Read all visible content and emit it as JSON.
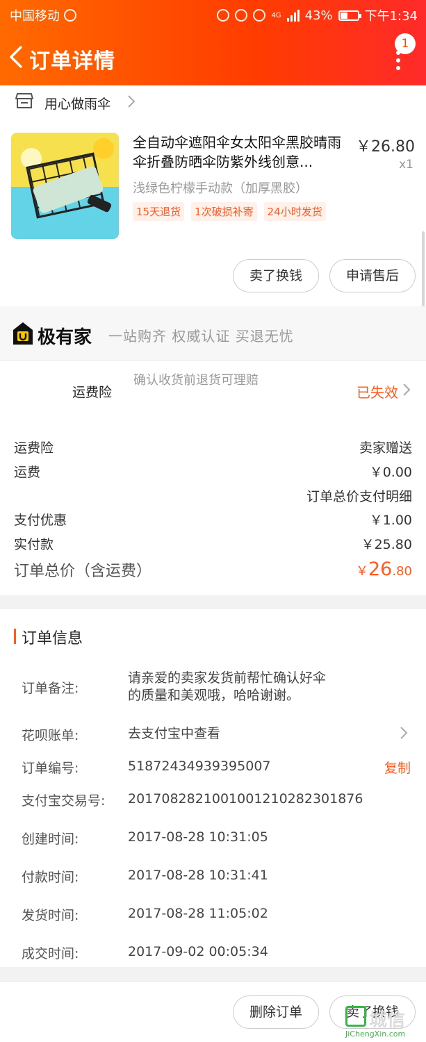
{
  "status_bar": {
    "carrier": "中国移动",
    "network": "4G",
    "battery": "43%",
    "battery_level": 0.43,
    "time": "下午1:34"
  },
  "nav": {
    "title": "订单详情",
    "badge": "1"
  },
  "shop": {
    "name": "用心做雨伞"
  },
  "product": {
    "title": "全自动伞遮阳伞女太阳伞黑胶晴雨伞折叠防晒伞防紫外线创意...",
    "price": "￥26.80",
    "qty": "x1",
    "sku": "浅绿色柠檬手动款（加厚黑胶）",
    "tags": [
      "15天退货",
      "1次破损补寄",
      "24小时发货"
    ]
  },
  "actions": {
    "sell": "卖了换钱",
    "after_sale": "申请售后"
  },
  "promo": {
    "name": "极有家",
    "slogan": "一站购齐 权威认证 买退无忧"
  },
  "insurance": {
    "label": "运费险",
    "desc": "确认收货前退货可理赔",
    "status": "已失效"
  },
  "fees": {
    "rows": [
      {
        "label": "运费险",
        "value": "卖家赠送"
      },
      {
        "label": "运费",
        "value": "￥0.00"
      },
      {
        "label": "",
        "value": "订单总价支付明细"
      },
      {
        "label": "支付优惠",
        "value": "￥1.00"
      },
      {
        "label": "实付款",
        "value": "￥25.80"
      }
    ],
    "total_label": "订单总价（含运费）",
    "total_prefix": "￥",
    "total_int": "26",
    "total_dec": ".80"
  },
  "order_info": {
    "title": "订单信息",
    "note_label": "订单备注:",
    "note_line1": "请亲爱的卖家发货前帮忙确认好伞",
    "note_line2": "的质量和美观哦，哈哈谢谢。",
    "huabei_label": "花呗账单:",
    "huabei_value": "去支付宝中查看",
    "order_no_label": "订单编号:",
    "order_no": "51872434939395007",
    "copy": "复制",
    "alipay_label": "支付宝交易号:",
    "alipay_no": "2017082821001001210282301876",
    "created_label": "创建时间:",
    "created": "2017-08-28 10:31:05",
    "paid_label": "付款时间:",
    "paid": "2017-08-28 10:31:41",
    "shipped_label": "发货时间:",
    "shipped": "2017-08-28 11:05:02",
    "done_label": "成交时间:",
    "done": "2017-09-02 00:05:34"
  },
  "bottom": {
    "delete": "删除订单",
    "sell": "卖了换钱"
  },
  "watermark": {
    "text": "城信",
    "url": "JiChengXin.com"
  }
}
